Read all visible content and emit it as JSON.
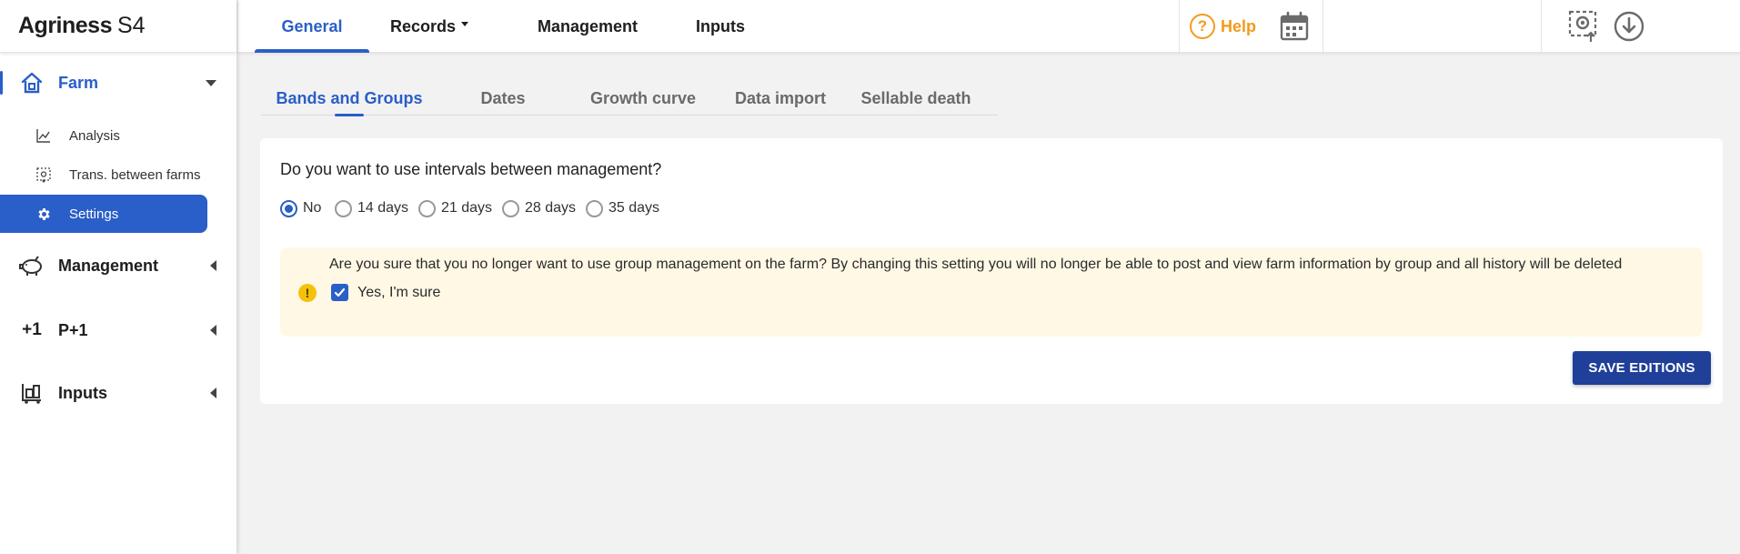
{
  "brand": {
    "name": "Agriness",
    "version": "S4"
  },
  "sidebar": {
    "groups": [
      {
        "label": "Farm",
        "icon": "house-icon",
        "expanded": true,
        "items": [
          {
            "label": "Analysis",
            "icon": "chart-line-icon"
          },
          {
            "label": "Trans. between farms",
            "icon": "transfer-icon"
          },
          {
            "label": "Settings",
            "icon": "gear-icon"
          }
        ]
      },
      {
        "label": "Management",
        "icon": "pig-icon"
      },
      {
        "label": "P+1",
        "icon": "plus-one-icon"
      },
      {
        "label": "Inputs",
        "icon": "cart-icon"
      }
    ],
    "active_item": "Settings"
  },
  "topnav": {
    "tabs": [
      {
        "label": "General",
        "active": true
      },
      {
        "label": "Records",
        "dropdown": true
      },
      {
        "label": "Management"
      },
      {
        "label": "Inputs"
      }
    ],
    "help_label": "Help",
    "help_icon": "question-circle-icon",
    "icons": [
      "calendar-icon",
      "upload-screen-icon",
      "download-circle-icon"
    ],
    "accent_color": "#2a5ec8",
    "help_color": "#f39a1c"
  },
  "subtabs": [
    {
      "label": "Bands and Groups",
      "active": true
    },
    {
      "label": "Dates"
    },
    {
      "label": "Growth curve"
    },
    {
      "label": "Data import"
    },
    {
      "label": "Sellable death"
    }
  ],
  "card": {
    "question": "Do you want to use intervals between management?",
    "options": [
      "No",
      "14 days",
      "21 days",
      "28 days",
      "35 days"
    ],
    "selected_option": "No",
    "warning": {
      "icon": "exclamation-icon",
      "text": "Are you sure that you no longer want to use group management on the farm? By changing this setting you will no longer be able to post and view farm information by group and all history will be deleted",
      "confirm_label": "Yes, I'm sure",
      "confirmed": true
    },
    "save_label": "SAVE EDITIONS"
  }
}
